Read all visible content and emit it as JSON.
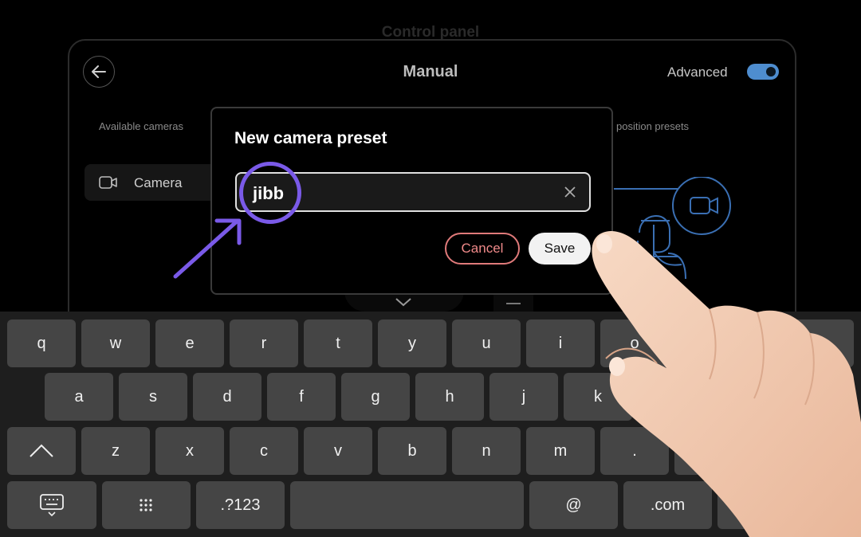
{
  "page": {
    "top_title": "Control panel",
    "header_title": "Manual",
    "advanced_label": "Advanced",
    "advanced_on": true,
    "accent_color": "#4e8dcf"
  },
  "panel": {
    "available_cameras_label": "Available cameras",
    "presets_label": "position presets",
    "camera_item_label": "Camera"
  },
  "dialog": {
    "title": "New camera preset",
    "input_value": "jibb",
    "cancel_label": "Cancel",
    "save_label": "Save"
  },
  "keyboard": {
    "row1": [
      "q",
      "w",
      "e",
      "r",
      "t",
      "y",
      "u",
      "i",
      "o"
    ],
    "row2": [
      "a",
      "s",
      "d",
      "f",
      "g",
      "h",
      "j",
      "k"
    ],
    "row3": [
      "z",
      "x",
      "c",
      "v",
      "b",
      "n",
      "m",
      "."
    ],
    "numbers_label": ".?123",
    "at_label": "@",
    "com_label": ".com"
  },
  "colors": {
    "highlight": "#7a5ae8",
    "cancel": "#e07a7a"
  }
}
